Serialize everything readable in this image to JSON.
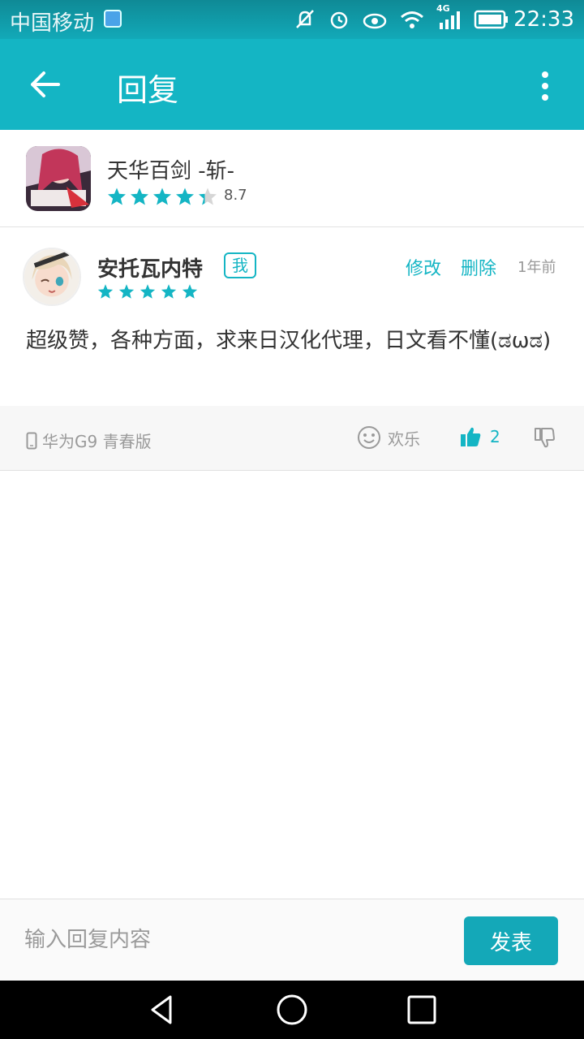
{
  "statusbar": {
    "carrier": "中国移动",
    "network": "4G",
    "time": "22:33"
  },
  "appbar": {
    "title": "回复"
  },
  "app": {
    "name": "天华百剑 -斩-",
    "rating": 4.35,
    "score": "8.7"
  },
  "review": {
    "author": "安托瓦内特",
    "me_tag": "我",
    "stars": 5,
    "edit_label": "修改",
    "delete_label": "删除",
    "time_ago": "1年前",
    "text": "超级赞，各种方面，求来日汉化代理，日文看不懂(ಡωಡ)",
    "device": "华为G9 青春版",
    "mood": "欢乐",
    "likes": "2"
  },
  "reply": {
    "placeholder": "输入回复内容",
    "send_label": "发表"
  },
  "colors": {
    "accent": "#14b5c4",
    "appbar": "#14b5c4",
    "button": "#14a8b8"
  }
}
